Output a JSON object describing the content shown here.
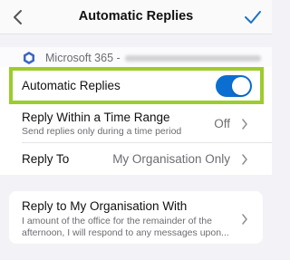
{
  "header": {
    "title": "Automatic Replies"
  },
  "account": {
    "label": "Microsoft 365 -"
  },
  "settings": {
    "automatic_replies": {
      "label": "Automatic Replies",
      "enabled": true
    },
    "reply_time_range": {
      "title": "Reply Within a Time Range",
      "subtitle": "Send replies only during a time period",
      "value": "Off"
    },
    "reply_to": {
      "title": "Reply To",
      "value": "My Organisation Only"
    }
  },
  "message": {
    "title": "Reply to My Organisation With",
    "body": "I amount of the office for the remainder of the afternoon, I will respond to any messages upon..."
  },
  "colors": {
    "accent": "#0a6fd1",
    "highlight": "#9ccc2d"
  }
}
